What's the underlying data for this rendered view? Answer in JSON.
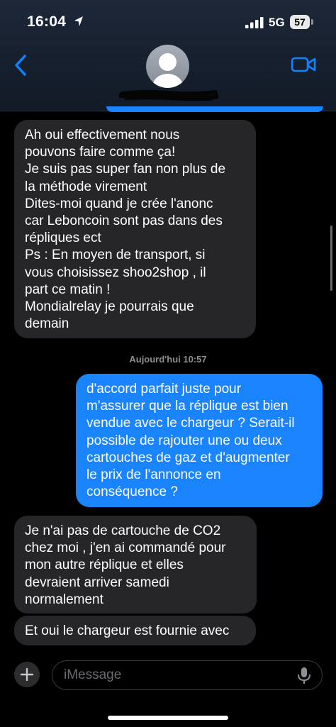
{
  "status_bar": {
    "time": "16:04",
    "network": "5G",
    "battery": "57"
  },
  "header": {
    "back_icon": "chevron-left-icon",
    "avatar_icon": "person-icon",
    "video_icon": "video-camera-icon",
    "accent": "#0a84ff"
  },
  "messages": [
    {
      "direction": "incoming",
      "text": "Ah oui effectivement nous\npouvons faire comme ça!\nJe suis pas super fan non plus de\nla méthode virement\nDites-moi quand je crée l'anonc\ncar Leboncoin sont pas dans des\nrépliques ect\nPs : En moyen de transport, si\nvous choisissez shoo2shop , il\npart ce matin !\nMondialrelay je pourrais que\ndemain"
    },
    {
      "direction": "outgoing",
      "text": "d'accord parfait juste pour\nm'assurer que la réplique est bien\nvendue avec le chargeur ? Serait-il\npossible de rajouter une ou deux\ncartouches de gaz et d'augmenter\nle prix de l'annonce en\nconséquence ?"
    },
    {
      "direction": "incoming",
      "text": "Je n'ai pas de cartouche de CO2\nchez moi , j'en ai commandé pour\nmon autre réplique et elles\ndevraient arriver samedi\nnormalement"
    },
    {
      "direction": "incoming",
      "text": "Et oui le chargeur est fournie avec"
    }
  ],
  "timestamp": "Aujourd'hui 10:57",
  "composer": {
    "placeholder": "iMessage",
    "plus_icon": "plus-icon",
    "mic_icon": "microphone-icon"
  },
  "colors": {
    "incoming_bubble": "#262629",
    "outgoing_bubble": "#1a84ff",
    "background": "#000000"
  }
}
